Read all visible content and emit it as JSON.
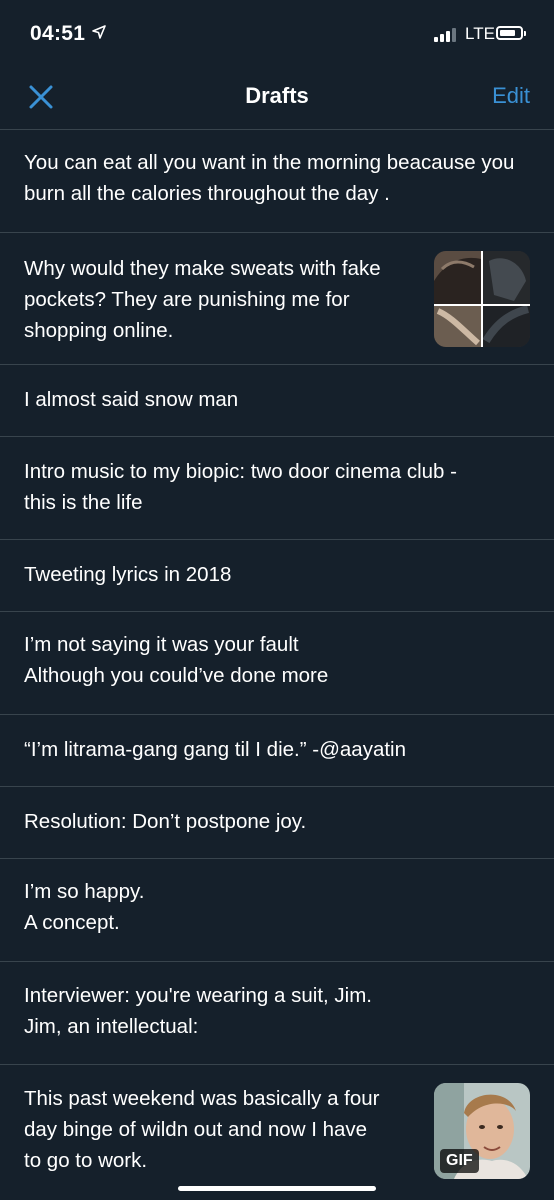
{
  "status_bar": {
    "time": "04:51",
    "network": "LTE",
    "icons": [
      "location-arrow-icon",
      "signal-bars-icon",
      "battery-icon"
    ]
  },
  "nav": {
    "title": "Drafts",
    "edit_label": "Edit",
    "close_icon": "close-icon",
    "accent_color": "#3a91d5"
  },
  "drafts": [
    {
      "text": "You can eat all you want in the morning beacause you burn all the calories throughout the day ."
    },
    {
      "text": "Why would they make sweats with fake\npockets? They are punishing me for\nshopping online.",
      "media": "photo"
    },
    {
      "text": "I almost said snow man"
    },
    {
      "text": "Intro music to my biopic: two door cinema club -\nthis is the life"
    },
    {
      "text": "Tweeting lyrics in 2018"
    },
    {
      "text": "I’m not saying it was your fault\nAlthough you could’ve done more"
    },
    {
      "text": "“I’m litrama-gang gang til I die.” -@aayatin"
    },
    {
      "text": "Resolution: Don’t postpone joy."
    },
    {
      "text": "I’m so happy.\nA concept."
    },
    {
      "text": "Interviewer: you're wearing a suit, Jim.\nJim, an intellectual:"
    },
    {
      "text": "This past weekend was basically a four\nday binge of wildn out and now I have\nto go to work.",
      "media": "gif",
      "media_label": "GIF"
    }
  ],
  "colors": {
    "background": "#15202b",
    "divider": "#38444d",
    "text": "#ffffff"
  }
}
